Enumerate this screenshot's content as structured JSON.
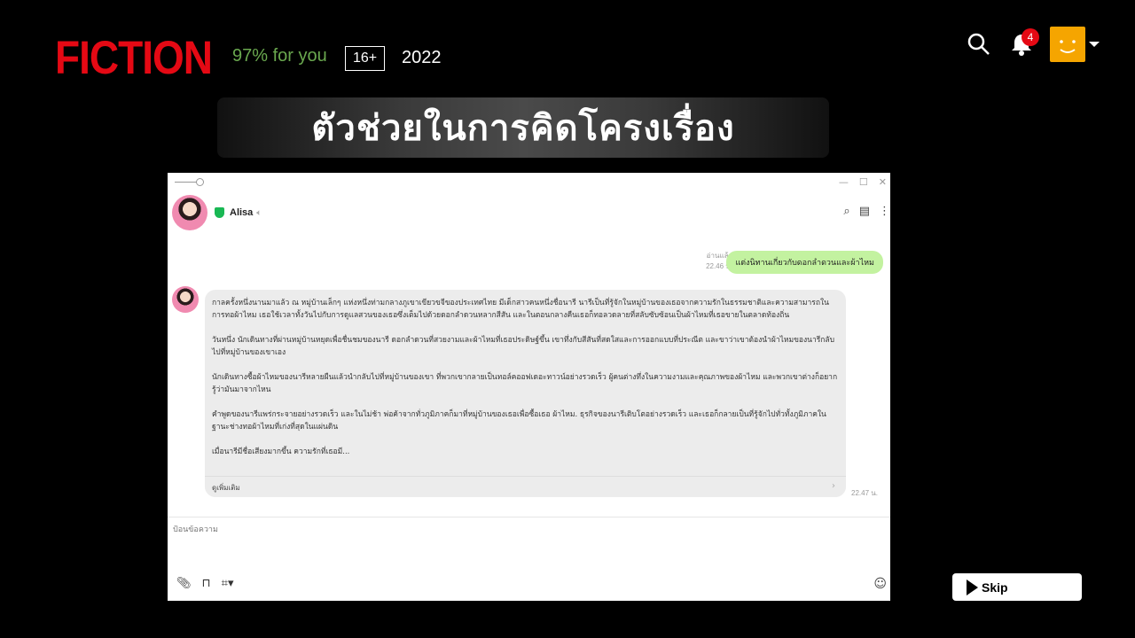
{
  "brand": {
    "name": "FICTION",
    "color": "#e50914"
  },
  "meta": {
    "match": "97% for you",
    "rating": "16+",
    "year": "2022"
  },
  "header": {
    "notification_count": "4"
  },
  "banner": {
    "text": "ตัวช่วยในการคิดโครงเรื่อง"
  },
  "chat": {
    "contact_name": "Alisa",
    "read_label": "อ่านแล้ว",
    "my_time": "22.46 น.",
    "my_message": "แต่งนิทานเกี่ยวกับดอกลำดวนและผ้าไหม",
    "reply_paragraphs": [
      "กาลครั้งหนึ่งนานมาแล้ว ณ หมู่บ้านเล็กๆ แห่งหนึ่งท่ามกลางภูเขาเขียวขจีของประเทศไทย มีเด็กสาวคนหนึ่งชื่อนารี นารีเป็นที่รู้จักในหมู่บ้านของเธอจากความรักในธรรมชาติและความสามารถในการทอผ้าไหม เธอใช้เวลาทั้งวันไปกับการดูแลสวนของเธอซึ่งเต็มไปด้วยดอกลำดวนหลากสีสัน และในตอนกลางคืนเธอก็ทอลวดลายที่สลับซับซ้อนเป็นผ้าไหมที่เธอขายในตลาดท้องถิ่น",
      "วันหนึ่ง นักเดินทางที่ผ่านหมู่บ้านหยุดเพื่อชื่นชมของนารี ดอกลำดวนที่สวยงามและผ้าไหมที่เธอประดิษฐ์ขึ้น เขาทึ่งกับสีสันที่สดใสและการออกแบบที่ประณีต และขาว่าเขาต้องนำผ้าไหมของนารีกลับไปที่หมู่บ้านของเขาเอง",
      "นักเดินทางซื้อผ้าไหมของนารีหลายผืนแล้วนำกลับไปที่หมู่บ้านของเขา ที่พวกเขากลายเป็นทอล์คออฟเดอะทาวน์อย่างรวดเร็ว ผู้คนต่างทึ่งในความงามและคุณภาพของผ้าไหม และพวกเขาต่างก็อยากรู้ว่ามันมาจากไหน",
      "คำพูดของนารีแพร่กระจายอย่างรวดเร็ว และในไม่ช้า พ่อค้าจากทั่วภูมิภาคก็มาที่หมู่บ้านของเธอเพื่อซื้อเธอ ผ้าไหม. ธุรกิจของนารีเติบโตอย่างรวดเร็ว และเธอก็กลายเป็นที่รู้จักไปทั่วทั้งภูมิภาคในฐานะช่างทอผ้าไหมที่เก่งที่สุดในแผ่นดิน",
      "เมื่อนารีมีชื่อเสียงมากขึ้น ความรักที่เธอมี..."
    ],
    "read_more": "ดูเพิ่มเติม",
    "reply_time": "22.47 น.",
    "input_placeholder": "ป้อนข้อความ"
  },
  "skip": {
    "label": "Skip"
  },
  "colors": {
    "accent": "#e50914",
    "match_green": "#6aa84f",
    "my_bubble": "#c3f2a0",
    "avatar_orange": "#f5a500"
  }
}
